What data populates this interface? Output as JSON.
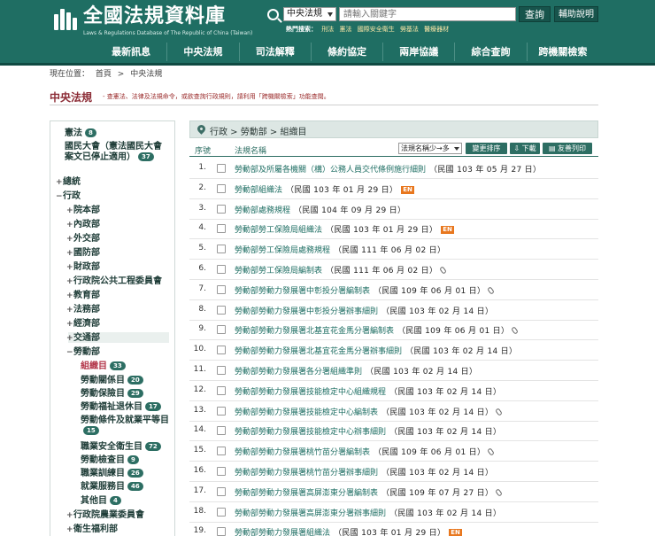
{
  "header": {
    "site_title": "全國法規資料庫",
    "site_subtitle": "Laws & Regulations Database of The Republic of China (Taiwan)",
    "search_scope": "中央法規",
    "search_placeholder": "請輸入關鍵字",
    "search_button": "查詢",
    "help_button": "輔助說明",
    "hot_label": "熱門搜索：",
    "hot_keywords": [
      "刑法",
      "憲法",
      "國際安全衛生",
      "勞基法",
      "醫療器材"
    ]
  },
  "nav": [
    "最新訊息",
    "中央法規",
    "司法解釋",
    "條約協定",
    "兩岸協議",
    "綜合查詢",
    "跨機關檢索"
  ],
  "breadcrumb": [
    "現在位置：",
    "首頁",
    ">",
    "中央法規"
  ],
  "page": {
    "title": "中央法規",
    "description": "- 查憲法、法律及法規命令，或欲查詢行政規則，請利用「跨機關檢索」功能查閱。"
  },
  "sidebar": [
    {
      "label": "憲法",
      "badge": "8",
      "toggle": ""
    },
    {
      "label": "國民大會（憲法國民大會案文已停止適用）",
      "badge": "37",
      "toggle": ""
    },
    {
      "label": "總統",
      "badge": "",
      "toggle": "+"
    },
    {
      "label": "行政",
      "badge": "",
      "toggle": "−"
    },
    {
      "label": "院本部",
      "badge": "",
      "toggle": "+"
    },
    {
      "label": "內政部",
      "badge": "",
      "toggle": "+"
    },
    {
      "label": "外交部",
      "badge": "",
      "toggle": "+"
    },
    {
      "label": "國防部",
      "badge": "",
      "toggle": "+"
    },
    {
      "label": "財政部",
      "badge": "",
      "toggle": "+"
    },
    {
      "label": "行政院公共工程委員會",
      "badge": "",
      "toggle": "+"
    },
    {
      "label": "教育部",
      "badge": "",
      "toggle": "+"
    },
    {
      "label": "法務部",
      "badge": "",
      "toggle": "+"
    },
    {
      "label": "經濟部",
      "badge": "",
      "toggle": "+"
    },
    {
      "label": "交通部",
      "badge": "",
      "toggle": "+"
    },
    {
      "label": "勞動部",
      "badge": "",
      "toggle": "−"
    },
    {
      "label": "組織目",
      "badge": "33",
      "toggle": ""
    },
    {
      "label": "勞動關係目",
      "badge": "20",
      "toggle": ""
    },
    {
      "label": "勞動保險目",
      "badge": "29",
      "toggle": ""
    },
    {
      "label": "勞動福祉退休目",
      "badge": "17",
      "toggle": ""
    },
    {
      "label": "勞動條件及就業平等目",
      "badge": "15",
      "toggle": ""
    },
    {
      "label": "職業安全衛生目",
      "badge": "72",
      "toggle": ""
    },
    {
      "label": "勞動檢查目",
      "badge": "9",
      "toggle": ""
    },
    {
      "label": "職業訓練目",
      "badge": "26",
      "toggle": ""
    },
    {
      "label": "就業服務目",
      "badge": "46",
      "toggle": ""
    },
    {
      "label": "其他目",
      "badge": "4",
      "toggle": ""
    },
    {
      "label": "行政院農業委員會",
      "badge": "",
      "toggle": "+"
    },
    {
      "label": "衛生福利部",
      "badge": "",
      "toggle": "+"
    }
  ],
  "main": {
    "crumb": "行政 > 勞動部 > 組織目",
    "col_no": "序號",
    "col_name": "法規名稱",
    "sort_option": "法規名稱少→多",
    "btn_sort": "變更排序",
    "btn_download": "下載",
    "btn_print": "友善列印",
    "en_label": "EN",
    "rows": [
      {
        "no": "1.",
        "name": "勞動部及所屬各機關（構）公務人員交代條例施行細則",
        "date": "（民國 103 年 05 月 27 日）",
        "en": false,
        "clip": false
      },
      {
        "no": "2.",
        "name": "勞動部組織法",
        "date": "（民國 103 年 01 月 29 日）",
        "en": true,
        "clip": false
      },
      {
        "no": "3.",
        "name": "勞動部處務規程",
        "date": "（民國 104 年 09 月 29 日）",
        "en": false,
        "clip": false
      },
      {
        "no": "4.",
        "name": "勞動部勞工保險局組織法",
        "date": "（民國 103 年 01 月 29 日）",
        "en": true,
        "clip": false
      },
      {
        "no": "5.",
        "name": "勞動部勞工保險局處務規程",
        "date": "（民國 111 年 06 月 02 日）",
        "en": false,
        "clip": false
      },
      {
        "no": "6.",
        "name": "勞動部勞工保險局編制表",
        "date": "（民國 111 年 06 月 02 日）",
        "en": false,
        "clip": true
      },
      {
        "no": "7.",
        "name": "勞動部勞動力發展署中彰投分署編制表",
        "date": "（民國 109 年 06 月 01 日）",
        "en": false,
        "clip": true
      },
      {
        "no": "8.",
        "name": "勞動部勞動力發展署中彰投分署辦事細則",
        "date": "（民國 103 年 02 月 14 日）",
        "en": false,
        "clip": false
      },
      {
        "no": "9.",
        "name": "勞動部勞動力發展署北基宜花金馬分署編制表",
        "date": "（民國 109 年 06 月 01 日）",
        "en": false,
        "clip": true
      },
      {
        "no": "10.",
        "name": "勞動部勞動力發展署北基宜花金馬分署辦事細則",
        "date": "（民國 103 年 02 月 14 日）",
        "en": false,
        "clip": false
      },
      {
        "no": "11.",
        "name": "勞動部勞動力發展署各分署組織準則",
        "date": "（民國 103 年 02 月 14 日）",
        "en": false,
        "clip": false
      },
      {
        "no": "12.",
        "name": "勞動部勞動力發展署技能檢定中心組織規程",
        "date": "（民國 103 年 02 月 14 日）",
        "en": false,
        "clip": false
      },
      {
        "no": "13.",
        "name": "勞動部勞動力發展署技能檢定中心編制表",
        "date": "（民國 103 年 02 月 14 日）",
        "en": false,
        "clip": true
      },
      {
        "no": "14.",
        "name": "勞動部勞動力發展署技能檢定中心辦事細則",
        "date": "（民國 103 年 02 月 14 日）",
        "en": false,
        "clip": false
      },
      {
        "no": "15.",
        "name": "勞動部勞動力發展署桃竹苗分署編制表",
        "date": "（民國 109 年 06 月 01 日）",
        "en": false,
        "clip": true
      },
      {
        "no": "16.",
        "name": "勞動部勞動力發展署桃竹苗分署辦事細則",
        "date": "（民國 103 年 02 月 14 日）",
        "en": false,
        "clip": false
      },
      {
        "no": "17.",
        "name": "勞動部勞動力發展署高屏澎東分署編制表",
        "date": "（民國 109 年 07 月 27 日）",
        "en": false,
        "clip": true
      },
      {
        "no": "18.",
        "name": "勞動部勞動力發展署高屏澎東分署辦事細則",
        "date": "（民國 103 年 02 月 14 日）",
        "en": false,
        "clip": false
      },
      {
        "no": "19.",
        "name": "勞動部勞動力發展署組織法",
        "date": "（民國 103 年 01 月 29 日）",
        "en": true,
        "clip": false
      }
    ]
  },
  "colors": {
    "brand": "#1f6e63",
    "link": "#1e6e63",
    "title": "#8b2b35",
    "active": "#b3364a",
    "en_badge": "#e8771e"
  }
}
